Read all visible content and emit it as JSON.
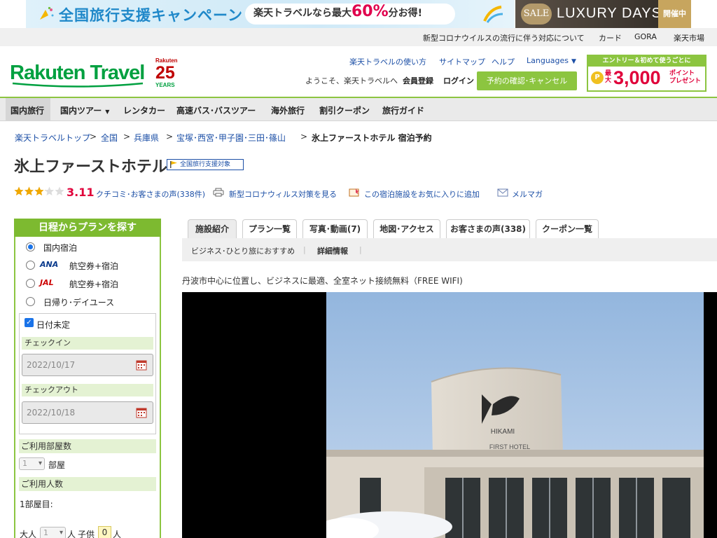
{
  "banner": {
    "campaign_title": "全国旅行支援キャンペーン",
    "campaign_pill_prefix": "楽天トラベルなら最大",
    "campaign_pill_percent": "60%",
    "campaign_pill_suffix": "分お得!",
    "sale_badge": "SALE",
    "luxury_title": "LUXURY DAYS",
    "luxury_tag": "開催中"
  },
  "utility_links": [
    "新型コロナウイルスの流行に伴う対応について",
    "カード",
    "GORA",
    "楽天市場"
  ],
  "header": {
    "logo": "Rakuten Travel",
    "years_brand": "Rakuten",
    "years_number": "25",
    "years_label": "YEARS",
    "links": [
      "楽天トラベルの使い方",
      "サイトマップ",
      "ヘルプ",
      "Languages"
    ],
    "welcome": "ようこそ、楽天トラベルへ",
    "register": "会員登録",
    "login": "ログイン",
    "confirm_button": "予約の確認･キャンセル",
    "promo_head": "エントリー＆初めて使うごとに",
    "promo_coin": "P",
    "promo_max": "最大",
    "promo_amount": "3,000",
    "promo_pt_line1": "ポイント",
    "promo_pt_line2": "プレゼント"
  },
  "nav": [
    "国内旅行",
    "国内ツアー",
    "レンタカー",
    "高速バス･バスツアー",
    "海外旅行",
    "割引クーポン",
    "旅行ガイド"
  ],
  "breadcrumb": {
    "items": [
      "楽天トラベルトップ",
      "全国",
      "兵庫県",
      "宝塚･西宮･甲子園･三田･篠山"
    ],
    "current": "氷上ファーストホテル 宿泊予約",
    "separator": ">"
  },
  "hotel": {
    "name": "氷上ファーストホテル",
    "support_badge": "全国旅行支援対象",
    "rating": "3.11",
    "rating_value": 3.11,
    "reviews_link": "クチコミ･お客さまの声(338件)",
    "actions": [
      "新型コロナウィルス対策を見る",
      "この宿泊施設をお気に入りに追加",
      "メルマガ"
    ]
  },
  "search": {
    "title": "日程からプランを探す",
    "options": [
      "国内宿泊",
      "航空券+宿泊",
      "航空券+宿泊",
      "日帰り･デイユース"
    ],
    "airlines": [
      "ANA",
      "JAL"
    ],
    "undecided_label": "日付未定",
    "checkin_label": "チェックイン",
    "checkin_value": "2022/10/17",
    "checkout_label": "チェックアウト",
    "checkout_value": "2022/10/18",
    "rooms_label": "ご利用部屋数",
    "rooms_value": "1",
    "rooms_unit": "部屋",
    "guests_label": "ご利用人数",
    "room1_label": "1部屋目:",
    "adult_label": "大人",
    "adult_value": "1",
    "adult_unit": "人",
    "child_label": "子供",
    "child_value": "0",
    "child_unit": "人"
  },
  "tabs": [
    "施設紹介",
    "プラン一覧",
    "写真･動画(7)",
    "地図･アクセス",
    "お客さまの声(338)",
    "クーポン一覧"
  ],
  "subnav": [
    "ビジネス･ひとり旅におすすめ",
    "詳細情報"
  ],
  "description": "丹波市中心に位置し、ビジネスに最適、全室ネット接続無料（FREE WIFI)",
  "photo": {
    "sign_text": "HIKAMI",
    "sign_text_2": "FIRST HOTEL"
  },
  "colors": {
    "brand_green": "#8cc540",
    "link_blue": "#1c4fa6",
    "rating_red": "#e0003a"
  }
}
